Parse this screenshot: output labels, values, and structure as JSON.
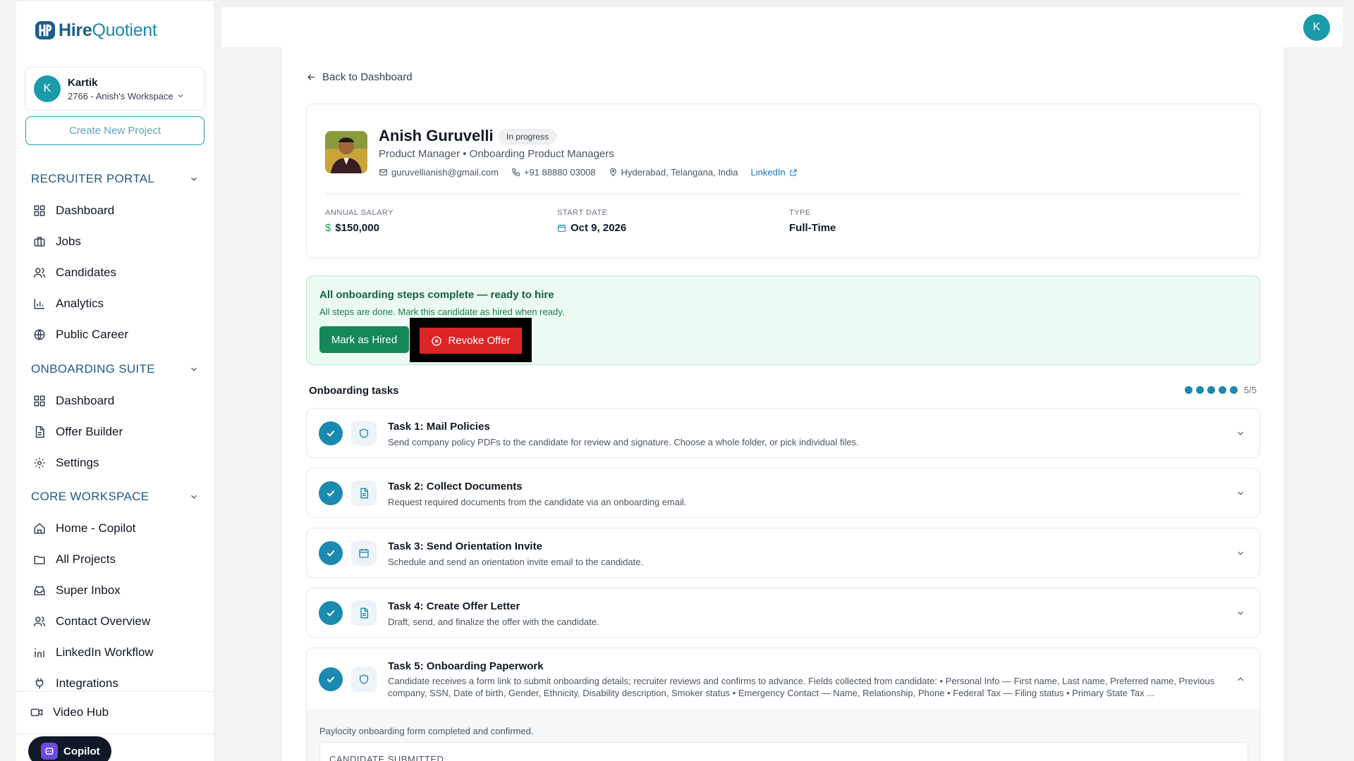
{
  "app": {
    "logo_part1": "Hire",
    "logo_part2": "Quotient"
  },
  "sidebar": {
    "user": {
      "initial": "K",
      "name": "Kartik",
      "workspace": "2766 - Anish's Workspace"
    },
    "create_project_label": "Create New Project",
    "sections": [
      {
        "title": "RECRUITER PORTAL",
        "items": [
          "Dashboard",
          "Jobs",
          "Candidates",
          "Analytics",
          "Public Career"
        ]
      },
      {
        "title": "ONBOARDING SUITE",
        "items": [
          "Dashboard",
          "Offer Builder",
          "Settings"
        ]
      },
      {
        "title": "CORE WORKSPACE",
        "items": [
          "Home - Copilot",
          "All Projects",
          "Super Inbox",
          "Contact Overview",
          "LinkedIn Workflow",
          "Integrations"
        ]
      }
    ],
    "footer_item": "Video Hub",
    "copilot_label": "Copilot"
  },
  "header": {
    "avatar_initial": "K"
  },
  "main": {
    "back_label": "Back to Dashboard",
    "candidate": {
      "name": "Anish Guruvelli",
      "status": "In progress",
      "role": "Product Manager • Onboarding Product Managers",
      "email": "guruvellianish@gmail.com",
      "phone": "+91 88880 03008",
      "location": "Hyderabad, Telangana, India",
      "linkedin_label": "LinkedIn",
      "salary_label": "ANNUAL SALARY",
      "salary": "$150,000",
      "start_label": "START DATE",
      "start": "Oct 9, 2026",
      "type_label": "TYPE",
      "type": "Full-Time"
    },
    "banner": {
      "title": "All onboarding steps complete — ready to hire",
      "subtitle": "All steps are done. Mark this candidate as hired when ready.",
      "hire_label": "Mark as Hired",
      "revoke_label": "Revoke Offer"
    },
    "tasks_title": "Onboarding tasks",
    "progress": {
      "done": 5,
      "total": 5,
      "label": "5/5"
    },
    "tasks": [
      {
        "title": "Task 1: Mail Policies",
        "desc": "Send company policy PDFs to the candidate for review and signature. Choose a whole folder, or pick individual files.",
        "icon": "shield-icon"
      },
      {
        "title": "Task 2: Collect Documents",
        "desc": "Request required documents from the candidate via an onboarding email.",
        "icon": "document-icon"
      },
      {
        "title": "Task 3: Send Orientation Invite",
        "desc": "Schedule and send an orientation invite email to the candidate.",
        "icon": "calendar-icon"
      },
      {
        "title": "Task 4: Create Offer Letter",
        "desc": "Draft, send, and finalize the offer with the candidate.",
        "icon": "document-icon"
      },
      {
        "title": "Task 5: Onboarding Paperwork",
        "desc": "Candidate receives a form link to submit onboarding details; recruiter reviews and confirms to advance. Fields collected from candidate: • Personal Info — First name, Last name, Preferred name, Previous company, SSN, Date of birth, Gender, Ethnicity, Disability description, Smoker status • Emergency Contact — Name, Relationship, Phone • Federal Tax — Filing status • Primary State Tax ...",
        "icon": "shield-icon"
      }
    ],
    "task5_note": "Paylocity onboarding form completed and confirmed.",
    "submitted_label": "CANDIDATE SUBMITTED"
  },
  "colors": {
    "brand": "#1b8ab0",
    "success": "#15885a",
    "danger": "#dc2626"
  }
}
